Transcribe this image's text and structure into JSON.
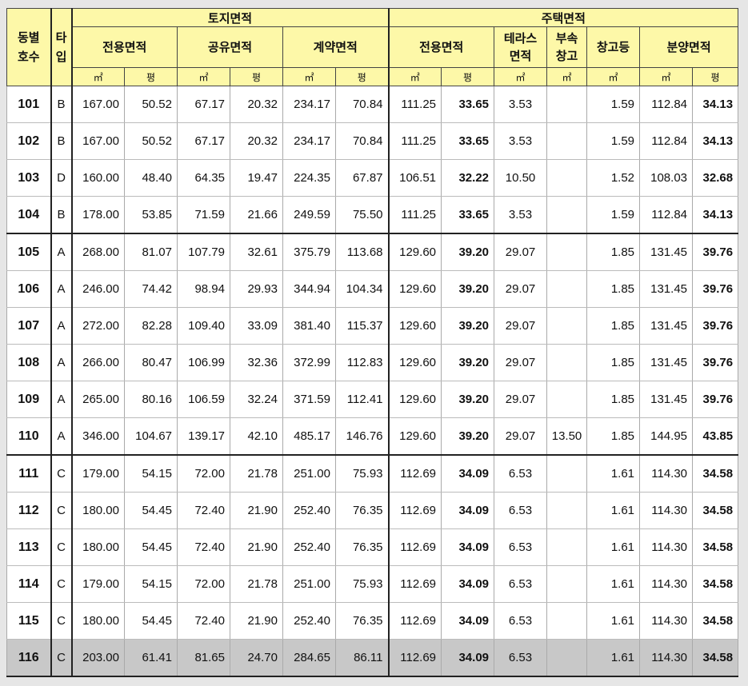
{
  "header": {
    "dong_ho": "동별\n호수",
    "type": "타\n입",
    "land_area": "토지면적",
    "house_area": "주택면적",
    "land_cols": [
      "전용면적",
      "공유면적",
      "계약면적"
    ],
    "house_cols": [
      "전용면적",
      "테라스\n면적",
      "부속\n창고",
      "창고등",
      "분양면적"
    ],
    "units": [
      "㎡",
      "평",
      "㎡",
      "평",
      "㎡",
      "평",
      "㎡",
      "평",
      "㎡",
      "㎡",
      "㎡",
      "㎡",
      "평"
    ]
  },
  "rows": [
    [
      "101",
      "B",
      "167.00",
      "50.52",
      "67.17",
      "20.32",
      "234.17",
      "70.84",
      "111.25",
      "33.65",
      "3.53",
      "",
      "1.59",
      "112.84",
      "34.13"
    ],
    [
      "102",
      "B",
      "167.00",
      "50.52",
      "67.17",
      "20.32",
      "234.17",
      "70.84",
      "111.25",
      "33.65",
      "3.53",
      "",
      "1.59",
      "112.84",
      "34.13"
    ],
    [
      "103",
      "D",
      "160.00",
      "48.40",
      "64.35",
      "19.47",
      "224.35",
      "67.87",
      "106.51",
      "32.22",
      "10.50",
      "",
      "1.52",
      "108.03",
      "32.68"
    ],
    [
      "104",
      "B",
      "178.00",
      "53.85",
      "71.59",
      "21.66",
      "249.59",
      "75.50",
      "111.25",
      "33.65",
      "3.53",
      "",
      "1.59",
      "112.84",
      "34.13"
    ],
    [
      "105",
      "A",
      "268.00",
      "81.07",
      "107.79",
      "32.61",
      "375.79",
      "113.68",
      "129.60",
      "39.20",
      "29.07",
      "",
      "1.85",
      "131.45",
      "39.76"
    ],
    [
      "106",
      "A",
      "246.00",
      "74.42",
      "98.94",
      "29.93",
      "344.94",
      "104.34",
      "129.60",
      "39.20",
      "29.07",
      "",
      "1.85",
      "131.45",
      "39.76"
    ],
    [
      "107",
      "A",
      "272.00",
      "82.28",
      "109.40",
      "33.09",
      "381.40",
      "115.37",
      "129.60",
      "39.20",
      "29.07",
      "",
      "1.85",
      "131.45",
      "39.76"
    ],
    [
      "108",
      "A",
      "266.00",
      "80.47",
      "106.99",
      "32.36",
      "372.99",
      "112.83",
      "129.60",
      "39.20",
      "29.07",
      "",
      "1.85",
      "131.45",
      "39.76"
    ],
    [
      "109",
      "A",
      "265.00",
      "80.16",
      "106.59",
      "32.24",
      "371.59",
      "112.41",
      "129.60",
      "39.20",
      "29.07",
      "",
      "1.85",
      "131.45",
      "39.76"
    ],
    [
      "110",
      "A",
      "346.00",
      "104.67",
      "139.17",
      "42.10",
      "485.17",
      "146.76",
      "129.60",
      "39.20",
      "29.07",
      "13.50",
      "1.85",
      "144.95",
      "43.85"
    ],
    [
      "111",
      "C",
      "179.00",
      "54.15",
      "72.00",
      "21.78",
      "251.00",
      "75.93",
      "112.69",
      "34.09",
      "6.53",
      "",
      "1.61",
      "114.30",
      "34.58"
    ],
    [
      "112",
      "C",
      "180.00",
      "54.45",
      "72.40",
      "21.90",
      "252.40",
      "76.35",
      "112.69",
      "34.09",
      "6.53",
      "",
      "1.61",
      "114.30",
      "34.58"
    ],
    [
      "113",
      "C",
      "180.00",
      "54.45",
      "72.40",
      "21.90",
      "252.40",
      "76.35",
      "112.69",
      "34.09",
      "6.53",
      "",
      "1.61",
      "114.30",
      "34.58"
    ],
    [
      "114",
      "C",
      "179.00",
      "54.15",
      "72.00",
      "21.78",
      "251.00",
      "75.93",
      "112.69",
      "34.09",
      "6.53",
      "",
      "1.61",
      "114.30",
      "34.58"
    ],
    [
      "115",
      "C",
      "180.00",
      "54.45",
      "72.40",
      "21.90",
      "252.40",
      "76.35",
      "112.69",
      "34.09",
      "6.53",
      "",
      "1.61",
      "114.30",
      "34.58"
    ],
    [
      "116",
      "C",
      "203.00",
      "61.41",
      "81.65",
      "24.70",
      "284.65",
      "86.11",
      "112.69",
      "34.09",
      "6.53",
      "",
      "1.61",
      "114.30",
      "34.58"
    ]
  ],
  "colors": {
    "header_bg": "#fdf8a8",
    "highlight_row_bg": "#c8c8c8"
  }
}
